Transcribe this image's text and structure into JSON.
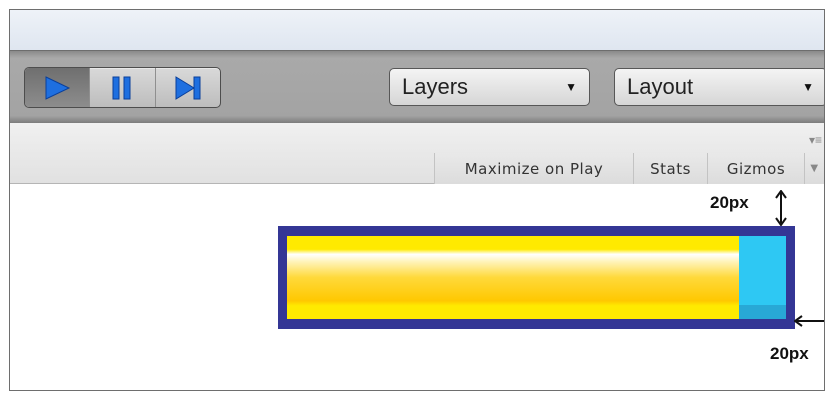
{
  "toolbar": {
    "play_controls": [
      {
        "name": "play",
        "icon": "play-icon",
        "active": true
      },
      {
        "name": "pause",
        "icon": "pause-icon",
        "active": false
      },
      {
        "name": "step",
        "icon": "step-icon",
        "active": false
      }
    ],
    "layers_label": "Layers",
    "layout_label": "Layout"
  },
  "game_panel": {
    "tabs": [
      "Maximize on Play",
      "Stats",
      "Gizmos"
    ],
    "menu_icon": "panel-menu-icon"
  },
  "annotations": {
    "top_gap": "20px",
    "right_gap": "20px"
  },
  "health_bar": {
    "fill_fraction": 0.905,
    "fill_color": "#ffd200",
    "background_color": "#2ec8f3",
    "border_color": "#343695"
  },
  "colors": {
    "icon_blue": "#1e6fe0"
  }
}
